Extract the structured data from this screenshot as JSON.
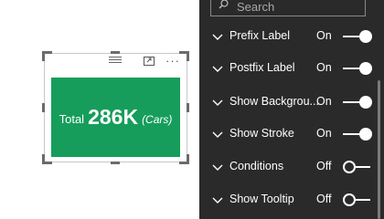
{
  "search": {
    "placeholder": "Search"
  },
  "card": {
    "prefix": "Total",
    "value": "286K",
    "postfix": "(Cars)",
    "background": "#169c5b"
  },
  "more_label": "···",
  "format_items": [
    {
      "label": "Prefix Label",
      "state": "On",
      "on": true
    },
    {
      "label": "Postfix Label",
      "state": "On",
      "on": true
    },
    {
      "label": "Show Backgrou...",
      "state": "On",
      "on": true
    },
    {
      "label": "Show Stroke",
      "state": "On",
      "on": true
    },
    {
      "label": "Conditions",
      "state": "Off",
      "on": false
    },
    {
      "label": "Show Tooltip",
      "state": "Off",
      "on": false
    }
  ],
  "colors": {
    "pane_bg": "#2a2a2a",
    "text": "#ffffff",
    "accent_green": "#169c5b"
  }
}
